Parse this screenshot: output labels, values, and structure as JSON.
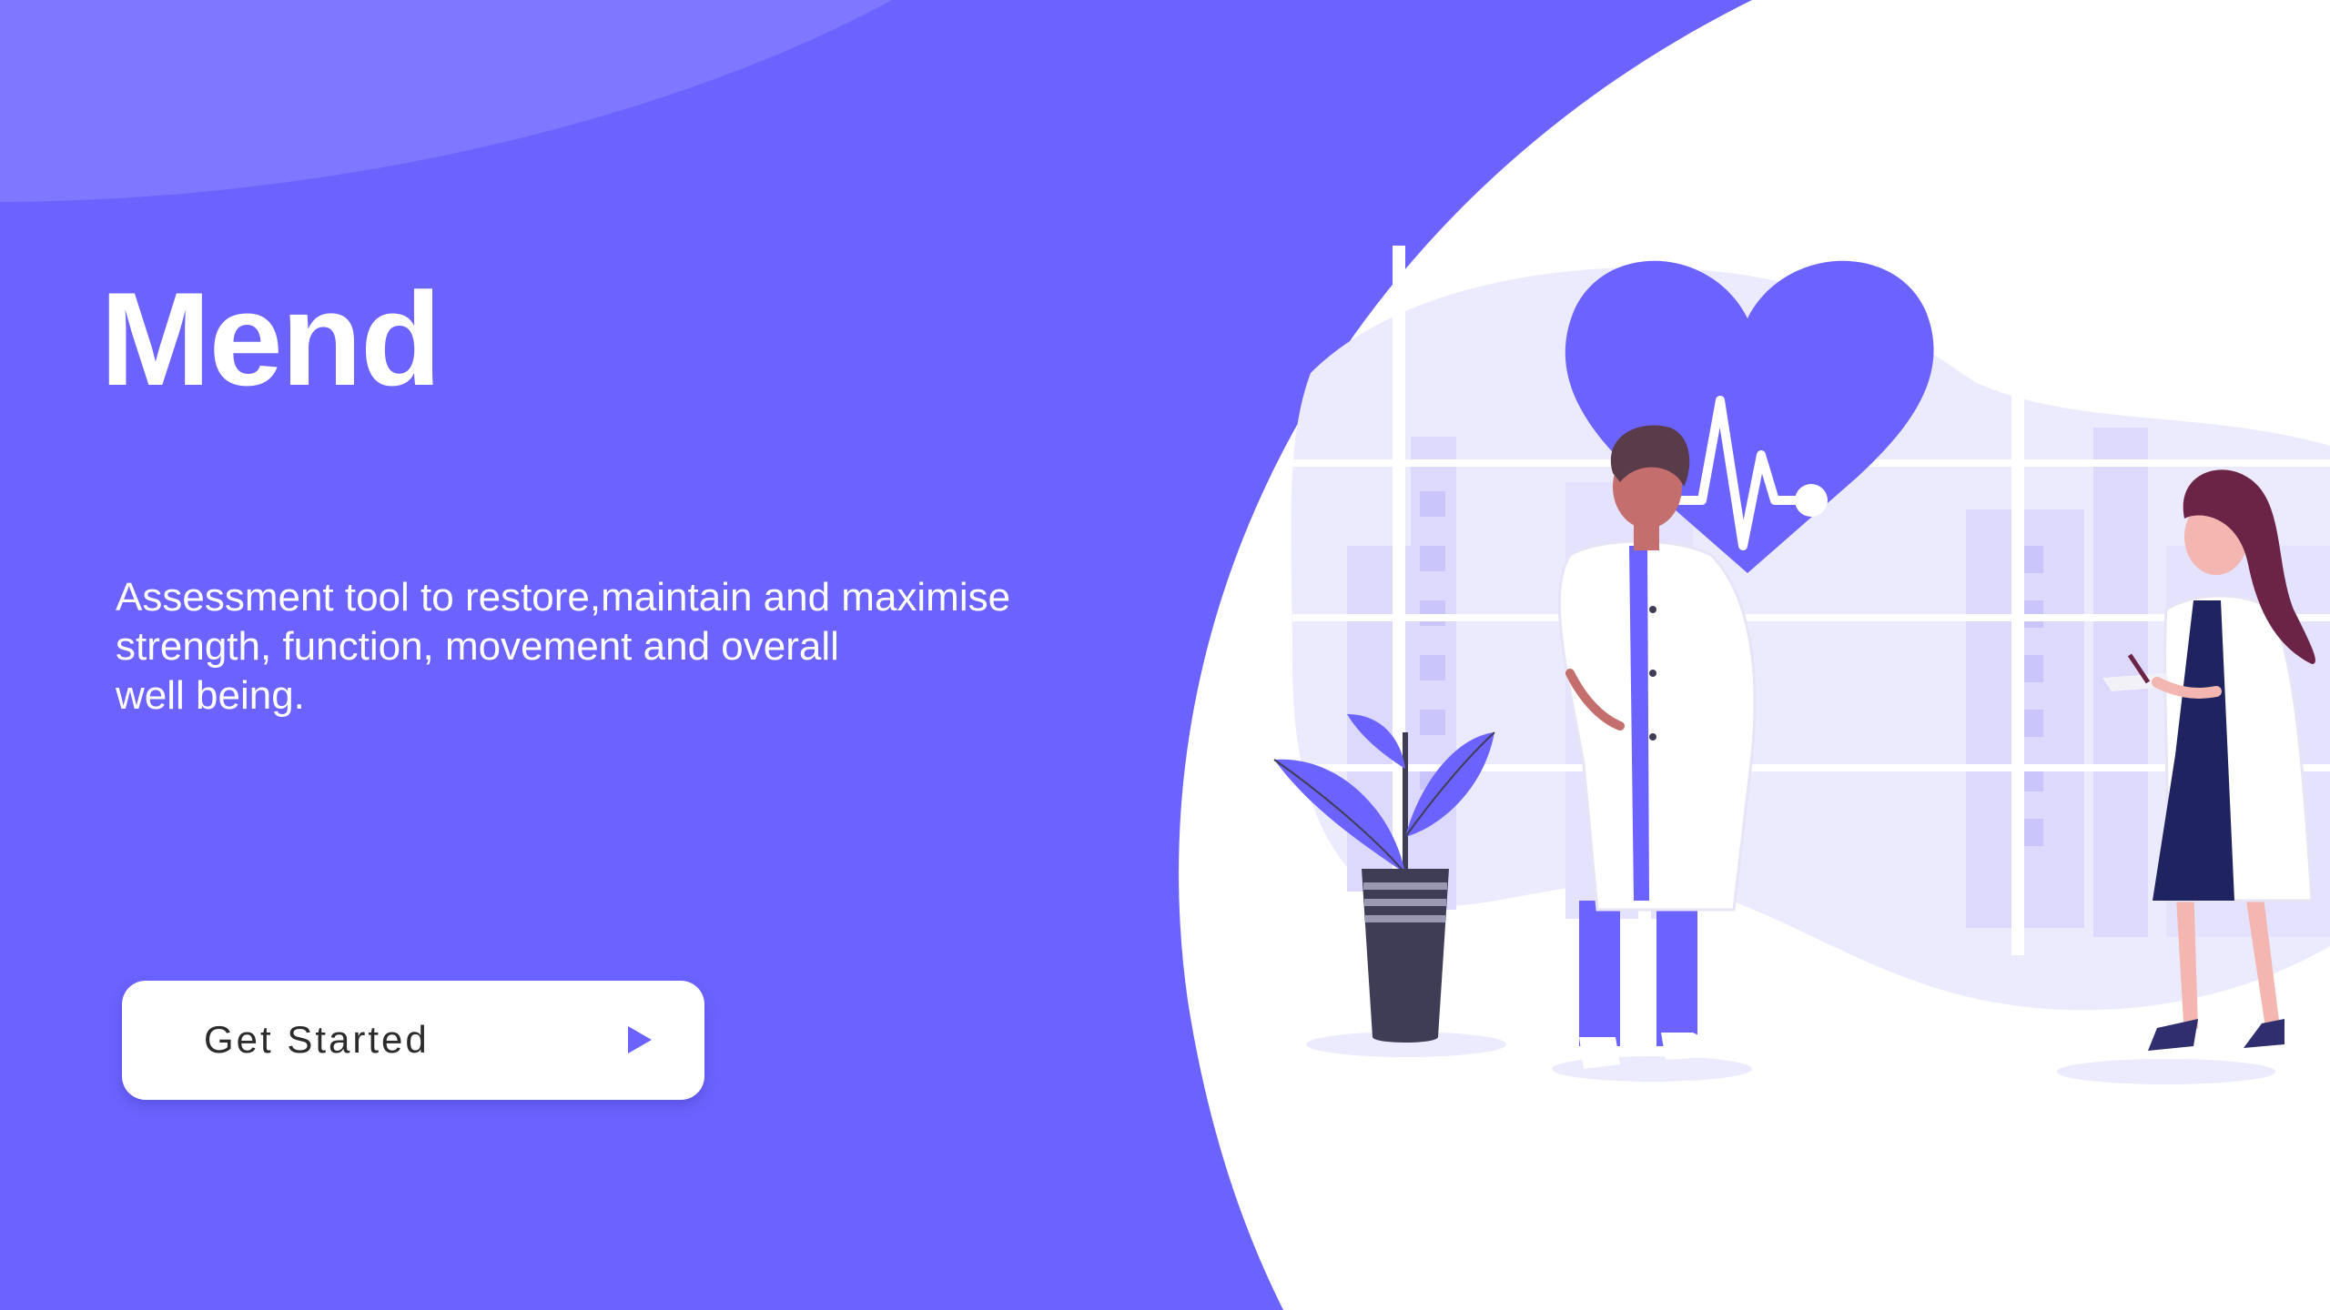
{
  "app": {
    "title": "Mend",
    "tagline_lines": [
      "Assessment tool to restore,maintain and maximise",
      "strength, function, movement and overall",
      "well being."
    ]
  },
  "cta": {
    "label": "Get Started",
    "icon": "play-arrow-icon"
  },
  "illustration": {
    "name": "doctors-illustration",
    "elements": [
      "heart-pulse-icon",
      "plant",
      "male-doctor",
      "female-doctor",
      "city-window"
    ]
  },
  "colors": {
    "primary": "#6c63ff",
    "primary_light": "#7f77ff",
    "background_right": "#ffffff",
    "text_on_primary": "#ffffff",
    "button_text": "#2b2b2b",
    "dark": "#3f3d56"
  }
}
